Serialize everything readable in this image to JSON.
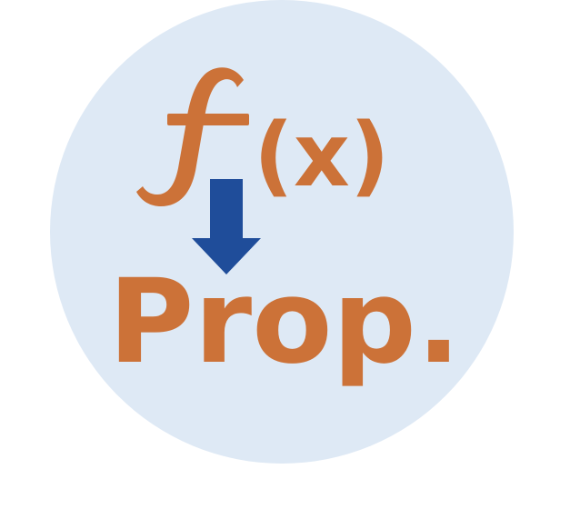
{
  "logo": {
    "function_symbol": "f(x)",
    "label": "Prop.",
    "colors": {
      "circle_background": "#dee9f5",
      "text_orange": "#cc7238",
      "arrow_blue": "#1f4d9a"
    },
    "arrow_icon": "arrow-down-icon"
  }
}
